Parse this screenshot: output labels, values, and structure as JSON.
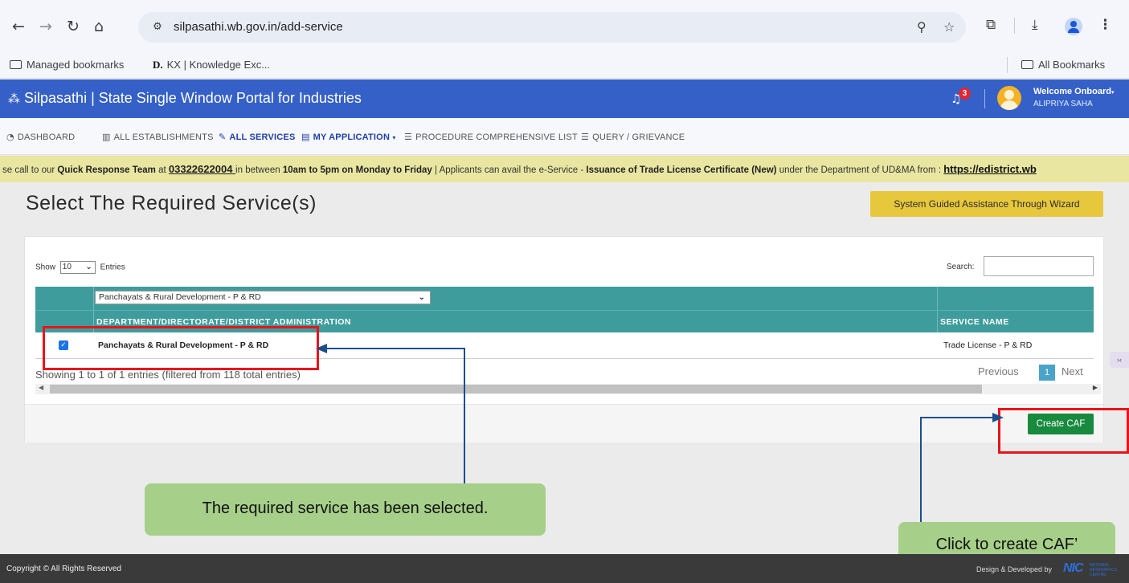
{
  "browser": {
    "url": "silpasathi.wb.gov.in/add-service",
    "bookmarks": [
      {
        "label": "Managed bookmarks"
      },
      {
        "label": "KX | Knowledge Exc...",
        "prefix": "D."
      }
    ],
    "all_bookmarks": "All Bookmarks"
  },
  "header": {
    "brand": "Silpasathi | State Single Window Portal for Industries",
    "notification_count": "3",
    "welcome": "Welcome Onboard",
    "username": "ALIPRIYA SAHA"
  },
  "menu": [
    {
      "label": "DASHBOARD",
      "icon": "gauge-icon"
    },
    {
      "label": "ALL ESTABLISHMENTS",
      "icon": "building-icon"
    },
    {
      "label": "ALL SERVICES",
      "icon": "wrench-icon",
      "active": true
    },
    {
      "label": "MY APPLICATION",
      "icon": "document-icon"
    },
    {
      "label": "PROCEDURE COMPREHENSIVE LIST",
      "icon": "list-icon"
    },
    {
      "label": "QUERY / GRIEVANCE",
      "icon": "list-icon"
    }
  ],
  "marquee": {
    "t1": "se call to our ",
    "t2": "Quick Response Team",
    "t3": " at ",
    "phone": "03322622004 ",
    "t4": "in between ",
    "t5": "10am to 5pm on Monday to Friday",
    "t6": " | Applicants can avail the e-Service - ",
    "t7": "Issuance of Trade License Certificate (New)",
    "t8": " under the Department of UD&MA from : ",
    "link": "https://edistrict.wb"
  },
  "page": {
    "title": "Select The Required Service(s)",
    "wizard_button": "System Guided Assistance Through Wizard"
  },
  "table": {
    "show_label": "Show",
    "page_size": "10",
    "entries_label": "Entries",
    "search_label": "Search:",
    "search_value": "",
    "department_filter": "Panchayats & Rural Development - P & RD",
    "headers": {
      "department": "DEPARTMENT/DIRECTORATE/DISTRICT ADMINISTRATION",
      "service": "SERVICE NAME"
    },
    "rows": [
      {
        "checked": true,
        "department": "Panchayats & Rural Development - P & RD",
        "service": "Trade License - P & RD"
      }
    ],
    "info": "Showing 1 to 1 of 1 entries (filtered from 118 total entries)",
    "pagination": {
      "previous": "Previous",
      "current": "1",
      "next": "Next"
    }
  },
  "actions": {
    "create_caf": "Create CAF"
  },
  "annotations": {
    "selected_note": "The required service has been selected.",
    "caf_note": "Click to create CAF’"
  },
  "footer": {
    "copyright": "Copyright © All Rights Reserved",
    "designed": "Design & Developed by",
    "logo_text": "NIC",
    "logo_subtext": "NATIONAL INFORMATICS CENTRE"
  },
  "colors": {
    "header_blue": "#3560c8",
    "table_teal": "#3f9c9c",
    "marquee_yellow": "#e9e6a1",
    "wizard_yellow": "#e7c73c",
    "caf_green": "#188a3e",
    "annotation_red": "#e8141c",
    "callout_green": "#a6cf89"
  }
}
